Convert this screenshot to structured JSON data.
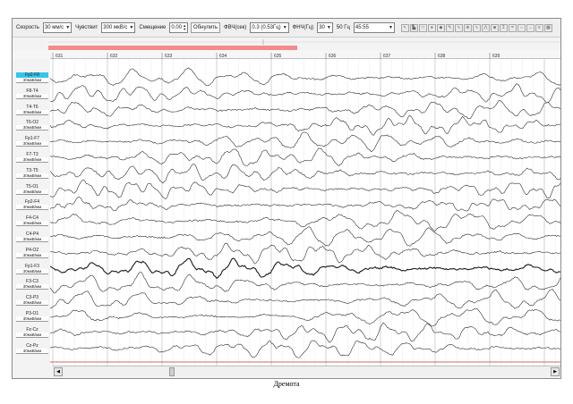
{
  "toolbar": {
    "speed_label": "Скорость",
    "speed_value": "30 мм/с",
    "sens_label": "Чувствит",
    "sens_value": "300 мкВ/с",
    "offset_label": "Смещение",
    "offset_value": "0.00",
    "reset_label": "Обнулить",
    "hff_label": "ФВЧ(сек)",
    "hff_value": "0.3 (0.53Гц)",
    "lff_label": "ФНЧ(Гц)",
    "lff_value": "30",
    "notch_label": "50 Гц",
    "time_value": "45:55"
  },
  "ruler": {
    "ticks": [
      "631",
      "632",
      "633",
      "634",
      "635",
      "636",
      "637",
      "638",
      "639"
    ]
  },
  "channels": [
    {
      "name": "Fp2-F8",
      "scale": "30мкВ/мм"
    },
    {
      "name": "F8-T4",
      "scale": "30мкВ/мм"
    },
    {
      "name": "T4-T6",
      "scale": "30мкВ/мм"
    },
    {
      "name": "T6-O2",
      "scale": "30мкВ/мм"
    },
    {
      "name": "Fp1-F7",
      "scale": "30мкВ/мм"
    },
    {
      "name": "F7-T3",
      "scale": "30мкВ/мм"
    },
    {
      "name": "T3-T5",
      "scale": "30мкВ/мм"
    },
    {
      "name": "T5-O1",
      "scale": "30мкВ/мм"
    },
    {
      "name": "Fp2-F4",
      "scale": "30мкВ/мм"
    },
    {
      "name": "F4-C4",
      "scale": "30мкВ/мм"
    },
    {
      "name": "C4-P4",
      "scale": "30мкВ/мм"
    },
    {
      "name": "P4-O2",
      "scale": "30мкВ/мм"
    },
    {
      "name": "Fp1-F3",
      "scale": "30мкВ/мм"
    },
    {
      "name": "F3-C3",
      "scale": "30мкВ/мм"
    },
    {
      "name": "C3-P3",
      "scale": "30мкВ/мм"
    },
    {
      "name": "P3-O1",
      "scale": "30мкВ/мм"
    },
    {
      "name": "Fz-Cz",
      "scale": "30мкВ/мм"
    },
    {
      "name": "Cz-Pz",
      "scale": "30мкВ/мм"
    }
  ],
  "selected_channel": 0,
  "colors": {
    "selected_label": "#37c6e8",
    "trace": "#1a1a1a",
    "marker_band": "#f28c8c",
    "baseline": "#c83232",
    "grid": "#b8b8b8"
  },
  "caption": "Дремота"
}
